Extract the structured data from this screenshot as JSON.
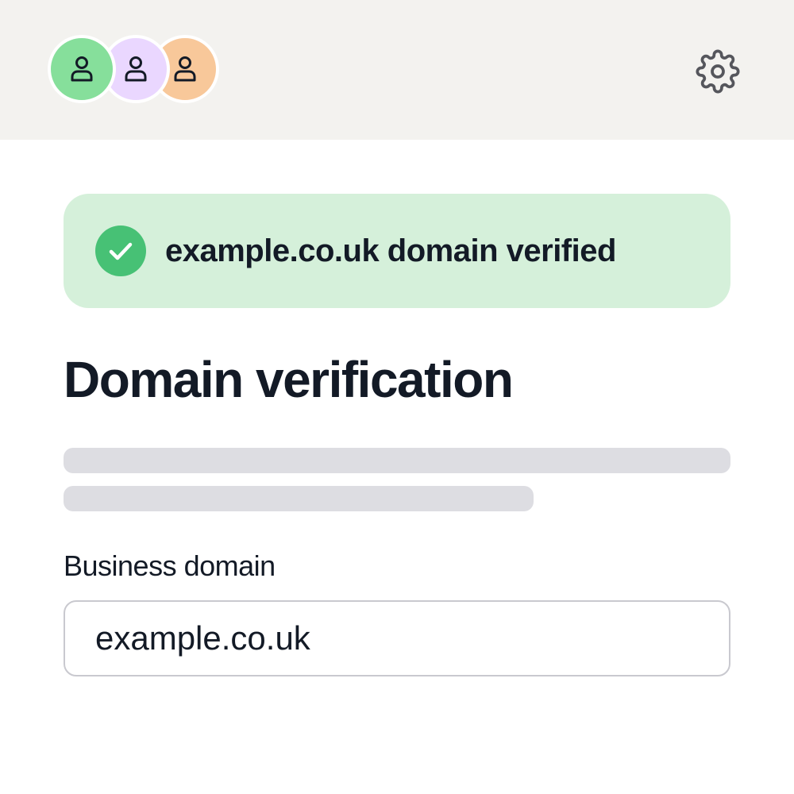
{
  "header": {
    "avatars": [
      {
        "icon": "user-icon",
        "bg": "#86df9b"
      },
      {
        "icon": "user-icon",
        "bg": "#ead7ff"
      },
      {
        "icon": "user-icon",
        "bg": "#f8c89a"
      }
    ],
    "settings_icon": "gear-icon"
  },
  "banner": {
    "message": "example.co.uk domain verified",
    "icon": "check-circle-icon",
    "bg": "#d5f0da",
    "icon_color": "#47c175"
  },
  "main": {
    "title": "Domain verification",
    "field": {
      "label": "Business domain",
      "value": "example.co.uk"
    }
  },
  "colors": {
    "text": "#131a26",
    "header_bg": "#f3f2ef",
    "skeleton": "#dddde2"
  }
}
